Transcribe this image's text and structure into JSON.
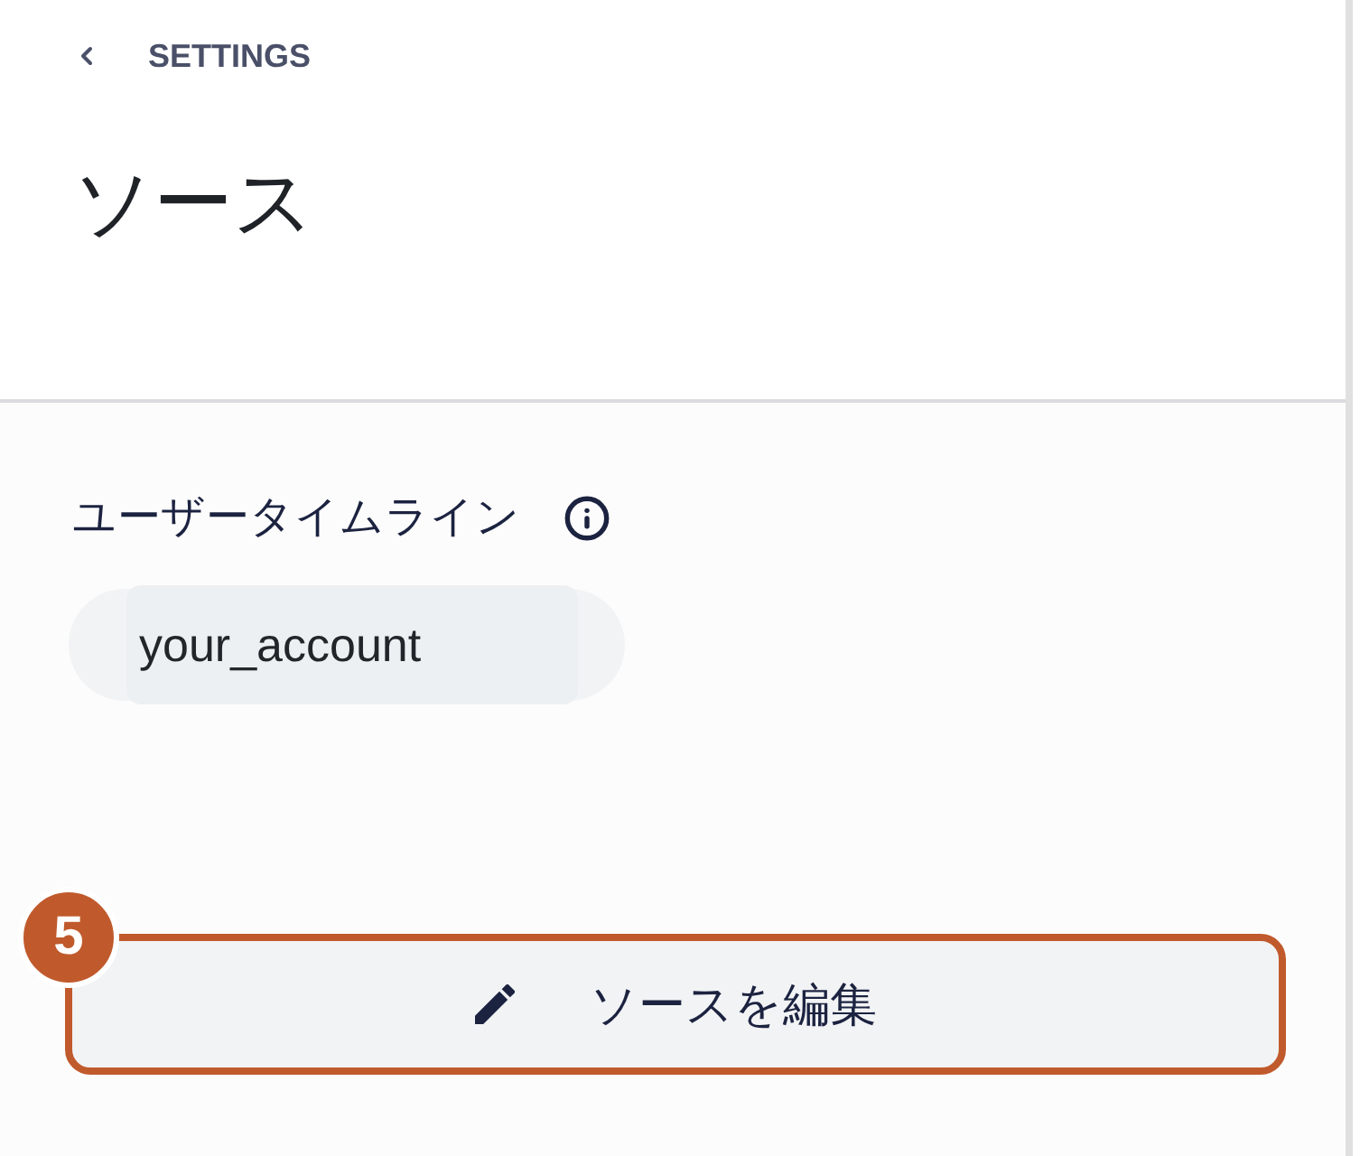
{
  "header": {
    "back_label": "SETTINGS",
    "title": "ソース"
  },
  "section": {
    "label": "ユーザータイムライン",
    "accounts": [
      {
        "value": "your_account"
      }
    ]
  },
  "edit_button": {
    "label": "ソースを編集",
    "step_badge": "5",
    "highlighted": true
  }
}
